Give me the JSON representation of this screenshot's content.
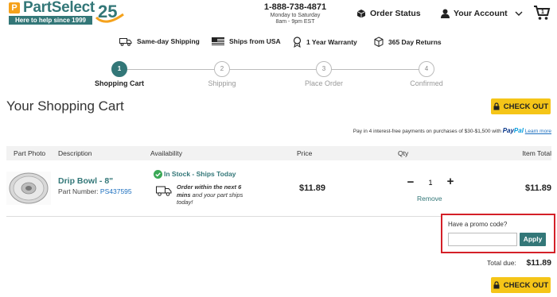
{
  "header": {
    "logo_letter": "P",
    "logo_name": "PartSelect",
    "logo_tagline": "Here to help since 1999",
    "logo_anniversary": "25",
    "phone": "1-888-738-4871",
    "hours_line1": "Monday to Saturday",
    "hours_line2": "8am - 9pm EST",
    "order_status": "Order Status",
    "account": "Your Account"
  },
  "features": [
    {
      "label": "Same-day Shipping",
      "icon": "truck-icon"
    },
    {
      "label": "Ships from USA",
      "icon": "us-flag-icon"
    },
    {
      "label": "1 Year Warranty",
      "icon": "ribbon-icon"
    },
    {
      "label": "365 Day Returns",
      "icon": "box-icon"
    }
  ],
  "steps": [
    {
      "num": "1",
      "label": "Shopping Cart",
      "active": true
    },
    {
      "num": "2",
      "label": "Shipping",
      "active": false
    },
    {
      "num": "3",
      "label": "Place Order",
      "active": false
    },
    {
      "num": "4",
      "label": "Confirmed",
      "active": false
    }
  ],
  "cart": {
    "title": "Your Shopping Cart",
    "checkout_label": "CHECK OUT",
    "pay4_text": "Pay in 4 interest-free payments on purchases of $30-$1,500 with",
    "paypal_1": "Pay",
    "paypal_2": "Pal",
    "learn_more": "Learn more",
    "columns": {
      "photo": "Part Photo",
      "description": "Description",
      "availability": "Availability",
      "price": "Price",
      "qty": "Qty",
      "total": "Item Total"
    },
    "item": {
      "name": "Drip Bowl - 8\"",
      "part_number_label": "Part Number:",
      "part_number": "PS437595",
      "stock": "In Stock - Ships Today",
      "order_within_1": "Order within the next 6 mins",
      "order_within_2": " and your part ships today!",
      "price": "$11.89",
      "qty": "1",
      "remove": "Remove",
      "total": "$11.89"
    },
    "promo_label": "Have a promo code?",
    "promo_placeholder": "",
    "apply_label": "Apply",
    "total_due_label": "Total due:",
    "total_due": "$11.89"
  },
  "colors": {
    "brand_teal": "#337778",
    "accent_yellow": "#f5c518",
    "logo_orange": "#f5a21c",
    "highlight_red": "#d42028"
  }
}
